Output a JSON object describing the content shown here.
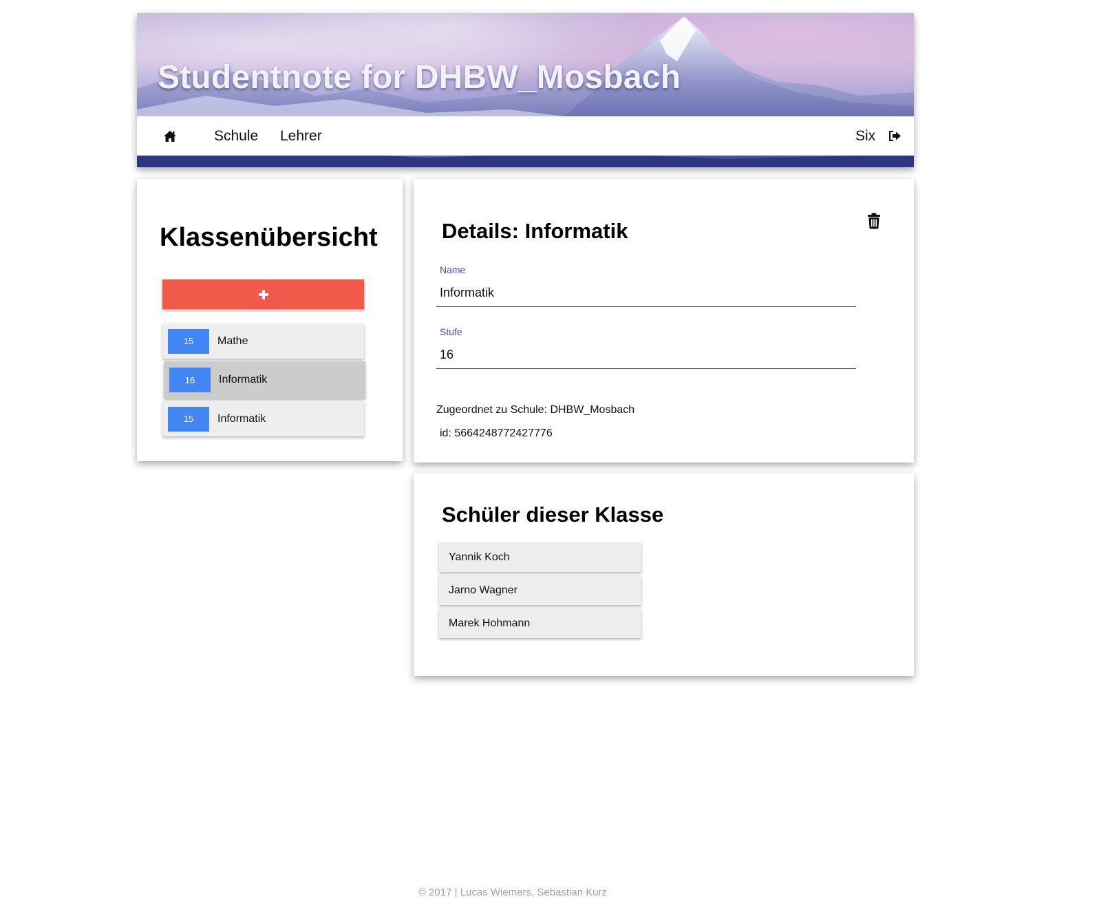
{
  "header": {
    "title": "Studentnote for DHBW_Mosbach"
  },
  "nav": {
    "home_icon": "home-icon",
    "schule": "Schule",
    "lehrer": "Lehrer",
    "user": "Six",
    "logout_icon": "sign-out-icon"
  },
  "classes": {
    "title": "Klassenübersicht",
    "add_icon": "plus-icon",
    "items": [
      {
        "stufe": "15",
        "name": "Mathe",
        "selected": false
      },
      {
        "stufe": "16",
        "name": "Informatik",
        "selected": true
      },
      {
        "stufe": "15",
        "name": "Informatik",
        "selected": false
      }
    ]
  },
  "details": {
    "title": "Details: Informatik",
    "delete_icon": "trash-icon",
    "name_label": "Name",
    "name_value": "Informatik",
    "stufe_label": "Stufe",
    "stufe_value": "16",
    "assigned": "Zugeordnet zu Schule: DHBW_Mosbach",
    "id": "id: 5664248772427776"
  },
  "students": {
    "title": "Schüler dieser Klasse",
    "items": [
      "Yannik Koch",
      "Jarno Wagner",
      "Marek Hohmann"
    ]
  },
  "footer": {
    "text": "© 2017 | Lucas Wiemers, Sebastian Kurz"
  },
  "colors": {
    "accent_red": "#f05a4a",
    "badge_blue": "#4285f4",
    "label_indigo": "#3f51b5"
  }
}
